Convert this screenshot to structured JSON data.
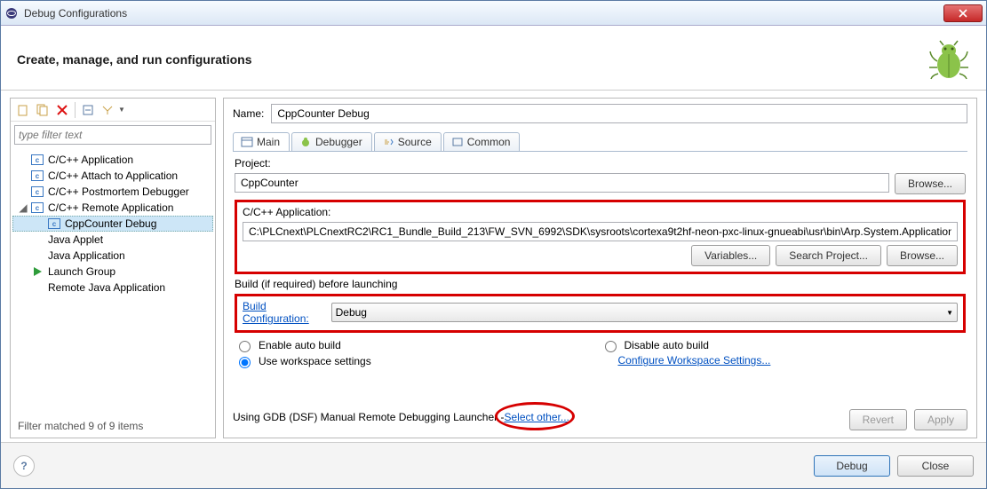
{
  "window": {
    "title": "Debug Configurations"
  },
  "header": {
    "title": "Create, manage, and run configurations"
  },
  "left": {
    "filter_placeholder": "type filter text",
    "items": [
      {
        "label": "C/C++ Application",
        "kind": "c"
      },
      {
        "label": "C/C++ Attach to Application",
        "kind": "c"
      },
      {
        "label": "C/C++ Postmortem Debugger",
        "kind": "c"
      },
      {
        "label": "C/C++ Remote Application",
        "kind": "c",
        "expanded": true,
        "children": [
          {
            "label": "CppCounter Debug",
            "kind": "c",
            "selected": true
          }
        ]
      },
      {
        "label": "Java Applet",
        "kind": "blank"
      },
      {
        "label": "Java Application",
        "kind": "blank"
      },
      {
        "label": "Launch Group",
        "kind": "play"
      },
      {
        "label": "Remote Java Application",
        "kind": "blank"
      }
    ],
    "footer": "Filter matched 9 of 9 items"
  },
  "right": {
    "name_label": "Name:",
    "name_value": "CppCounter Debug",
    "tabs": [
      "Main",
      "Debugger",
      "Source",
      "Common"
    ],
    "active_tab": 0,
    "main": {
      "project_label": "Project:",
      "project_value": "CppCounter",
      "browse": "Browse...",
      "app_label": "C/C++ Application:",
      "app_value": "C:\\PLCnext\\PLCnextRC2\\RC1_Bundle_Build_213\\FW_SVN_6992\\SDK\\sysroots\\cortexa9t2hf-neon-pxc-linux-gnueabi\\usr\\bin\\Arp.System.Application",
      "variables": "Variables...",
      "search_project": "Search Project...",
      "build_label": "Build (if required) before launching",
      "build_config_label": "Build Configuration:",
      "build_config_value": "Debug",
      "enable_auto": "Enable auto build",
      "disable_auto": "Disable auto build",
      "use_ws": "Use workspace settings",
      "config_ws": "Configure Workspace Settings..."
    },
    "launcher_text": "Using GDB (DSF) Manual Remote Debugging Launcher - ",
    "select_other": "Select other...",
    "revert": "Revert",
    "apply": "Apply"
  },
  "footer": {
    "debug": "Debug",
    "close": "Close"
  }
}
